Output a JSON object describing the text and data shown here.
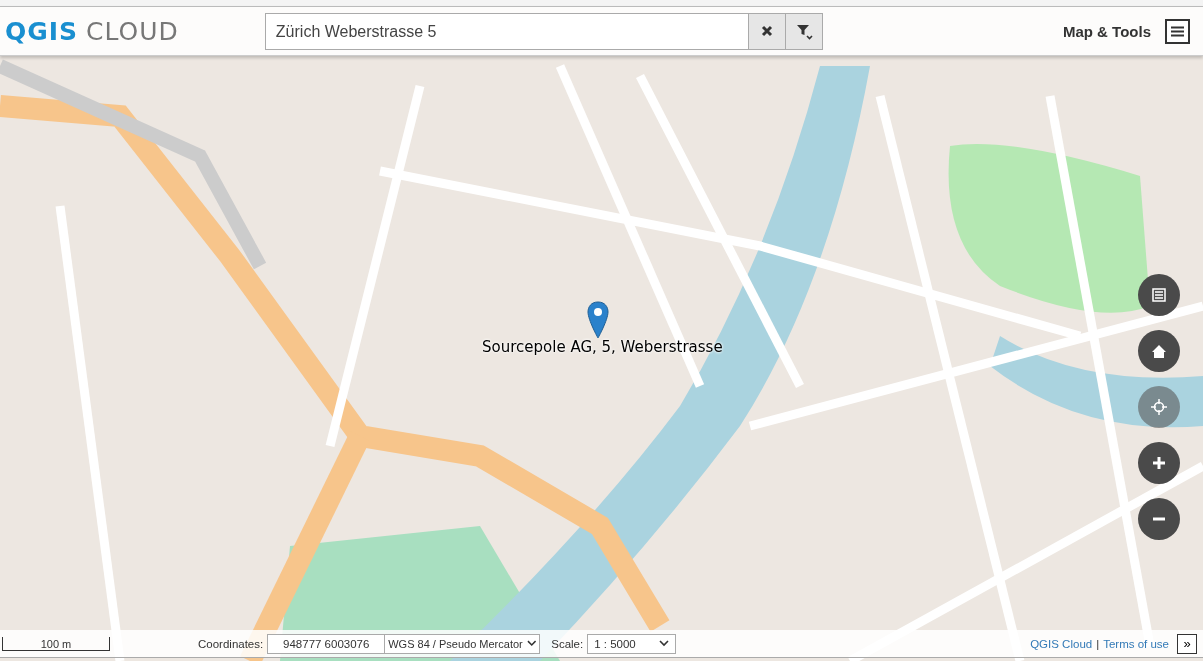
{
  "header": {
    "logo": {
      "primary": "QGIS",
      "secondary": "CLOUD"
    },
    "search": {
      "value": "Zürich Weberstrasse 5"
    },
    "menu": {
      "label": "Map & Tools"
    }
  },
  "map": {
    "marker": {
      "label": "Sourcepole AG, 5, Weberstrasse"
    },
    "buttons": [
      {
        "kind": "layers",
        "disabled": false
      },
      {
        "kind": "home",
        "disabled": false
      },
      {
        "kind": "locate",
        "disabled": true
      },
      {
        "kind": "zoom-in",
        "disabled": false
      },
      {
        "kind": "zoom-out",
        "disabled": false
      }
    ]
  },
  "bottom_bar": {
    "scale_bar": {
      "label": "100 m"
    },
    "coordinates": {
      "label": "Coordinates:",
      "value": "948777 6003076"
    },
    "crs": {
      "value": "WGS 84 / Pseudo Mercator"
    },
    "scale": {
      "label": "Scale:",
      "value": "1 : 5000"
    },
    "links": [
      {
        "text": "QGIS Cloud"
      },
      {
        "text": "Terms of use"
      }
    ],
    "separator": "|",
    "toggle": "»"
  }
}
